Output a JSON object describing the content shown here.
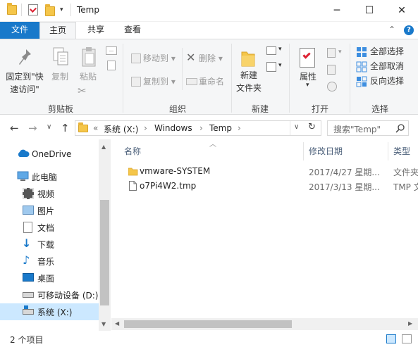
{
  "window": {
    "title": "Temp",
    "minimize_glyph": "─",
    "maximize_glyph": "☐",
    "close_glyph": "✕"
  },
  "ribbon_tabs": {
    "file": "文件",
    "home": "主页",
    "share": "共享",
    "view": "查看",
    "collapse_glyph": "⌃",
    "help_glyph": "?"
  },
  "ribbon": {
    "clipboard": {
      "pin_label_line1": "固定到\"快",
      "pin_label_line2": "速访问\"",
      "copy": "复制",
      "paste": "粘贴",
      "group": "剪贴板"
    },
    "organize": {
      "move_to": "移动到",
      "copy_to": "复制到",
      "delete": "删除",
      "rename": "重命名",
      "group": "组织"
    },
    "new": {
      "new_folder_line1": "新建",
      "new_folder_line2": "文件夹",
      "group": "新建"
    },
    "open": {
      "properties": "属性",
      "group": "打开"
    },
    "select": {
      "select_all": "全部选择",
      "select_none": "全部取消",
      "invert": "反向选择",
      "group": "选择"
    }
  },
  "address": {
    "back_glyph": "←",
    "forward_glyph": "→",
    "dropdown_glyph": "∨",
    "up_glyph": "↑",
    "overflow": "«",
    "crumbs": [
      "系统 (X:)",
      "Windows",
      "Temp"
    ],
    "crumb_sep": "›",
    "search_placeholder": "搜索\"Temp\"",
    "refresh_glyph": "↻"
  },
  "nav": {
    "onedrive": "OneDrive",
    "this_pc": "此电脑",
    "videos": "视频",
    "pictures": "图片",
    "documents": "文档",
    "downloads": "下载",
    "music": "音乐",
    "desktop": "桌面",
    "removable": "可移动设备 (D:)",
    "system": "系统 (X:)"
  },
  "columns": {
    "name": "名称",
    "date": "修改日期",
    "type": "类型"
  },
  "files": [
    {
      "name": "vmware-SYSTEM",
      "date": "2017/4/27 星期...",
      "type": "文件夹",
      "kind": "folder"
    },
    {
      "name": "o7Pi4W2.tmp",
      "date": "2017/3/13 星期...",
      "type": "TMP 文",
      "kind": "file"
    }
  ],
  "status": {
    "count": "2 个项目"
  },
  "colors": {
    "accent": "#1979ca",
    "selected": "#cce8ff",
    "ribbon_bg": "#f5f6f7",
    "folder": "#f5c64a"
  }
}
